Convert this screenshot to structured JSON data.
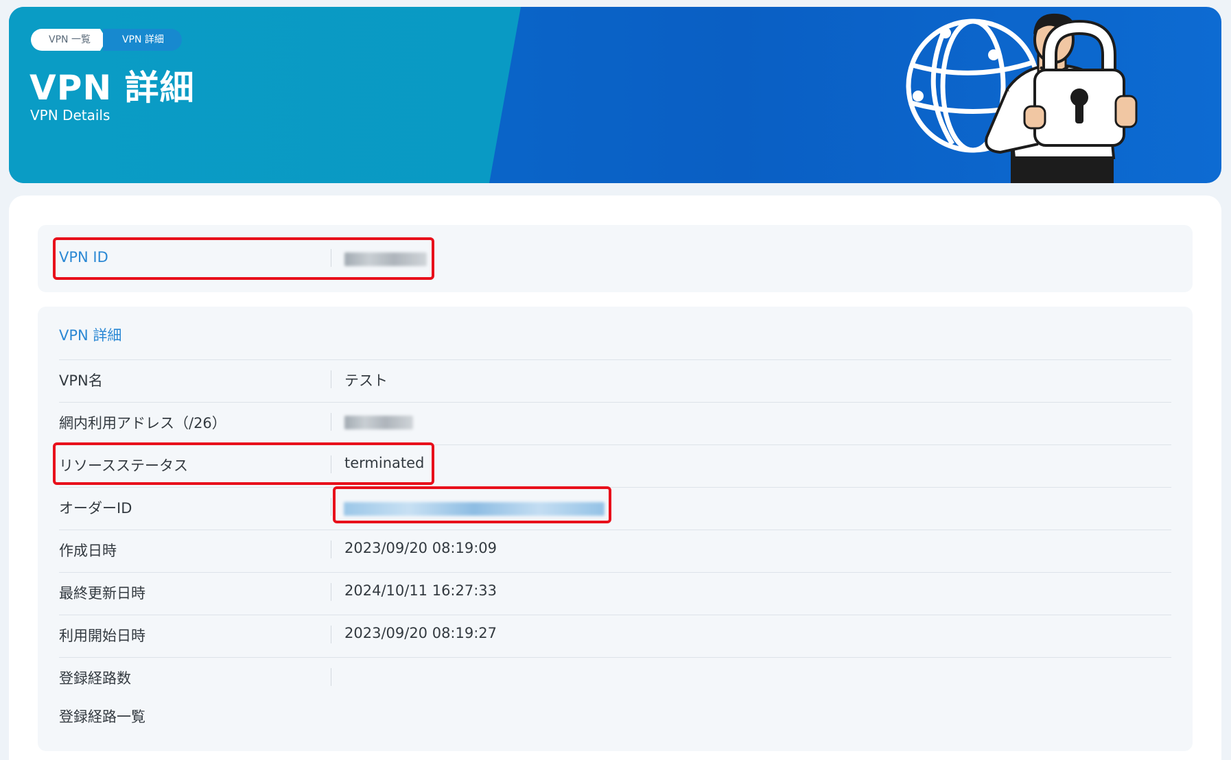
{
  "header": {
    "breadcrumb": [
      "VPN 一覧",
      "VPN 詳細"
    ],
    "title": "VPN 詳細",
    "subtitle": "VPN Details"
  },
  "id_section": {
    "label": "VPN ID",
    "value_redacted": true
  },
  "details_section": {
    "heading": "VPN 詳細",
    "rows": [
      {
        "label": "VPN名",
        "value": "テスト"
      },
      {
        "label": "網内利用アドレス（/26）",
        "value": ""
      },
      {
        "label": "リソースステータス",
        "value": "terminated"
      },
      {
        "label": "オーダーID",
        "value": ""
      },
      {
        "label": "作成日時",
        "value": "2023/09/20 08:19:09"
      },
      {
        "label": "最終更新日時",
        "value": "2024/10/11 16:27:33"
      },
      {
        "label": "利用開始日時",
        "value": "2023/09/20 08:19:27"
      },
      {
        "label": "登録経路数",
        "value": ""
      },
      {
        "label": "登録経路一覧",
        "value": ""
      }
    ]
  },
  "colors": {
    "highlight": "#e8101b",
    "link": "#2b88d4",
    "banner_teal": "#0a9cc5",
    "banner_blue": "#0a5fc4"
  },
  "icons": [
    "globe-icon",
    "padlock-icon",
    "person-illustration"
  ]
}
